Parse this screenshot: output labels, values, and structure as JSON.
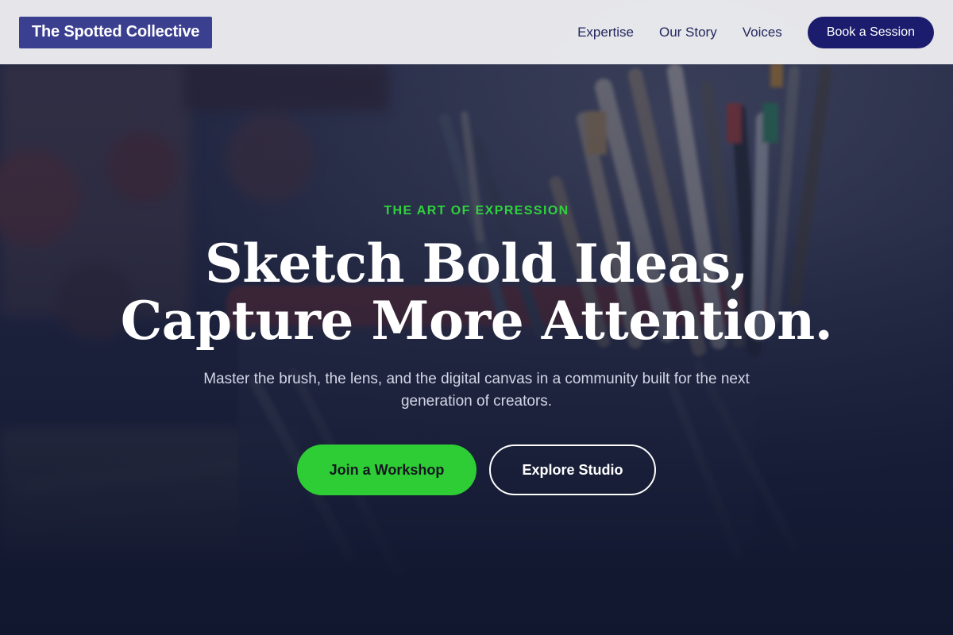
{
  "header": {
    "logo_text": "The Spotted Collective",
    "nav": [
      {
        "label": "Expertise"
      },
      {
        "label": "Our Story"
      },
      {
        "label": "Voices"
      }
    ],
    "cta_label": "Book a Session"
  },
  "hero": {
    "eyebrow": "THE ART OF EXPRESSION",
    "headline_line1": "Sketch Bold Ideas,",
    "headline_line2": "Capture More Attention.",
    "subtext": "Master the brush, the lens, and the digital canvas in a community built for the next generation of creators.",
    "primary_button": "Join a Workshop",
    "secondary_button": "Explore Studio",
    "background_image": "paint-brushes-in-jar"
  },
  "colors": {
    "brand": "#3b3f8f",
    "cta": "#1b1c6e",
    "accent_green": "#2ecc35",
    "nav_text": "#24275e"
  }
}
